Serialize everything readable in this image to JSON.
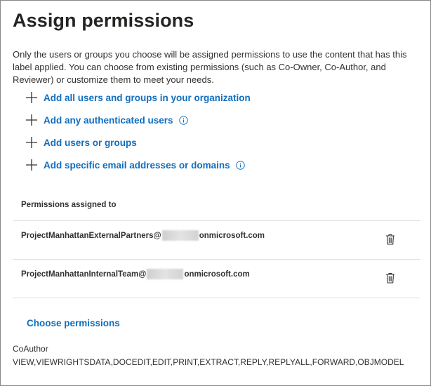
{
  "panel": {
    "title": "Assign permissions",
    "description": "Only the users or groups you choose will be assigned permissions to use the content that has this label applied. You can choose from existing permissions (such as Co-Owner, Co-Author, and Reviewer) or customize them to meet your needs."
  },
  "actions": [
    {
      "label": "Add all users and groups in your organization",
      "has_info": false
    },
    {
      "label": "Add any authenticated users",
      "has_info": true
    },
    {
      "label": "Add users or groups",
      "has_info": false
    },
    {
      "label": "Add specific email addresses or domains",
      "has_info": true
    }
  ],
  "permissions": {
    "header": "Permissions assigned to",
    "rows": [
      {
        "email_prefix": "ProjectManhattanExternalPartners@",
        "email_suffix": "onmicrosoft.com"
      },
      {
        "email_prefix": "ProjectManhattanInternalTeam@",
        "email_suffix": "onmicrosoft.com"
      }
    ]
  },
  "choose_permissions_label": "Choose permissions",
  "assigned_role": {
    "name": "CoAuthor",
    "rights": "VIEW,VIEWRIGHTSDATA,DOCEDIT,EDIT,PRINT,EXTRACT,REPLY,REPLYALL,FORWARD,OBJMODEL"
  },
  "colors": {
    "link": "#106ebe",
    "text": "#323130",
    "divider": "#e1dfdd",
    "border": "#8a8886"
  },
  "icons": {
    "add": "plus-icon",
    "info": "info-icon",
    "delete": "trash-icon"
  }
}
